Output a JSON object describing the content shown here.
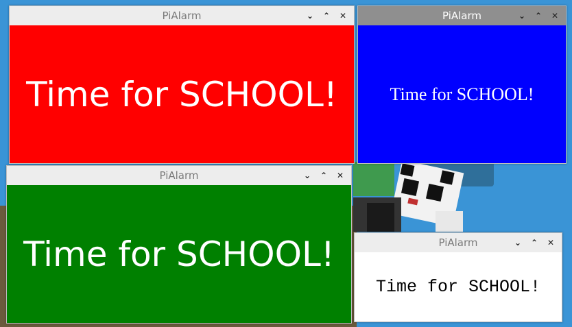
{
  "desktop": {
    "background_color": "#3a94d6"
  },
  "windows": [
    {
      "title": "PiAlarm",
      "message": "Time for SCHOOL!",
      "bg_color": "#ff0000",
      "text_color": "#ffffff",
      "font": "sans",
      "active": true
    },
    {
      "title": "PiAlarm",
      "message": "Time for SCHOOL!",
      "bg_color": "#0000ff",
      "text_color": "#ffffff",
      "font": "serif",
      "active": false
    },
    {
      "title": "PiAlarm",
      "message": "Time for SCHOOL!",
      "bg_color": "#008000",
      "text_color": "#ffffff",
      "font": "sans",
      "active": true
    },
    {
      "title": "PiAlarm",
      "message": "Time for SCHOOL!",
      "bg_color": "#ffffff",
      "text_color": "#000000",
      "font": "mono",
      "active": true
    }
  ],
  "controls": {
    "minimize_glyph": "⌄",
    "maximize_glyph": "⌃",
    "close_glyph": "✕"
  }
}
